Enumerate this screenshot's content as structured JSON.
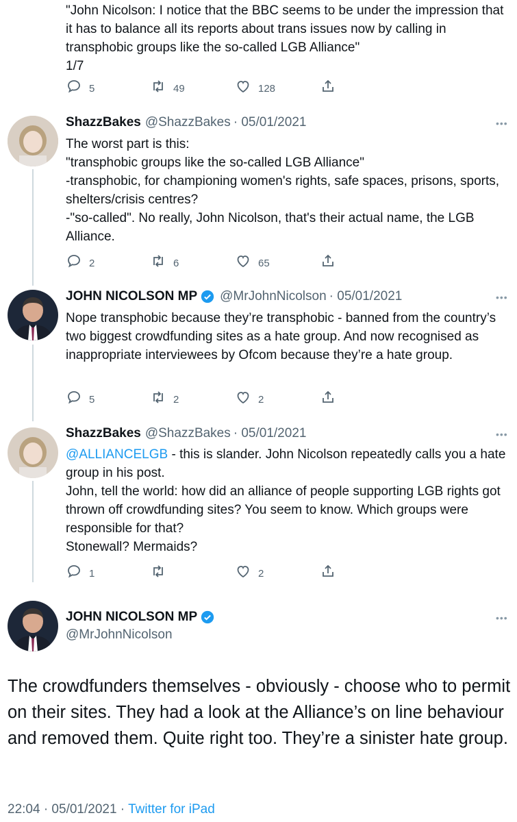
{
  "top_tweet": {
    "text": "\"John Nicolson: I notice that the BBC seems to be under the impression that it has to balance all its reports about trans issues now by calling in transphobic groups like the so-called LGB Alliance\"\n1/7",
    "replies": "5",
    "retweets": "49",
    "likes": "128"
  },
  "replies": [
    {
      "name": "ShazzBakes",
      "handle": "@ShazzBakes",
      "date": "· 05/01/2021",
      "text": "The worst part is this:\n\"transphobic groups like the so-called LGB Alliance\"\n-transphobic, for championing women's rights, safe spaces, prisons, sports, shelters/crisis centres?\n-\"so-called\". No really, John Nicolson, that's their actual name, the LGB Alliance.",
      "replies": "2",
      "retweets": "6",
      "likes": "65"
    },
    {
      "name": "JOHN NICOLSON MP",
      "handle": "@MrJohnNicolson",
      "date": "· 05/01/2021",
      "text": "Nope transphobic because they’re transphobic - banned from the country’s two biggest crowdfunding  sites as a hate group. And now recognised as inappropriate interviewees by Ofcom because they’re a hate group.",
      "replies": "5",
      "retweets": "2",
      "likes": "2"
    },
    {
      "name": "ShazzBakes",
      "handle": "@ShazzBakes",
      "date": "· 05/01/2021",
      "mention": "@ALLIANCELGB",
      "text": " - this is slander. John Nicolson repeatedly calls you a hate group in his post.\nJohn, tell the world: how did an alliance of people supporting LGB rights got thrown off crowdfunding sites? You seem to know. Which groups were responsible for that?\nStonewall? Mermaids?",
      "replies": "1",
      "retweets": "",
      "likes": "2"
    }
  ],
  "main_tweet": {
    "name": "JOHN NICOLSON MP",
    "handle": "@MrJohnNicolson",
    "text": "The crowdfunders themselves - obviously - choose who to permit on their sites. They had a look at the Alliance’s on line behaviour and removed them. Quite right too. They’re a sinister hate group.",
    "time": "22:04 · 05/01/2021 · ",
    "source": "Twitter for iPad"
  },
  "more_label": "•••",
  "colors": {
    "accent": "#1d9bf0",
    "secondary": "#536471",
    "verified": "#1d9bf0"
  }
}
